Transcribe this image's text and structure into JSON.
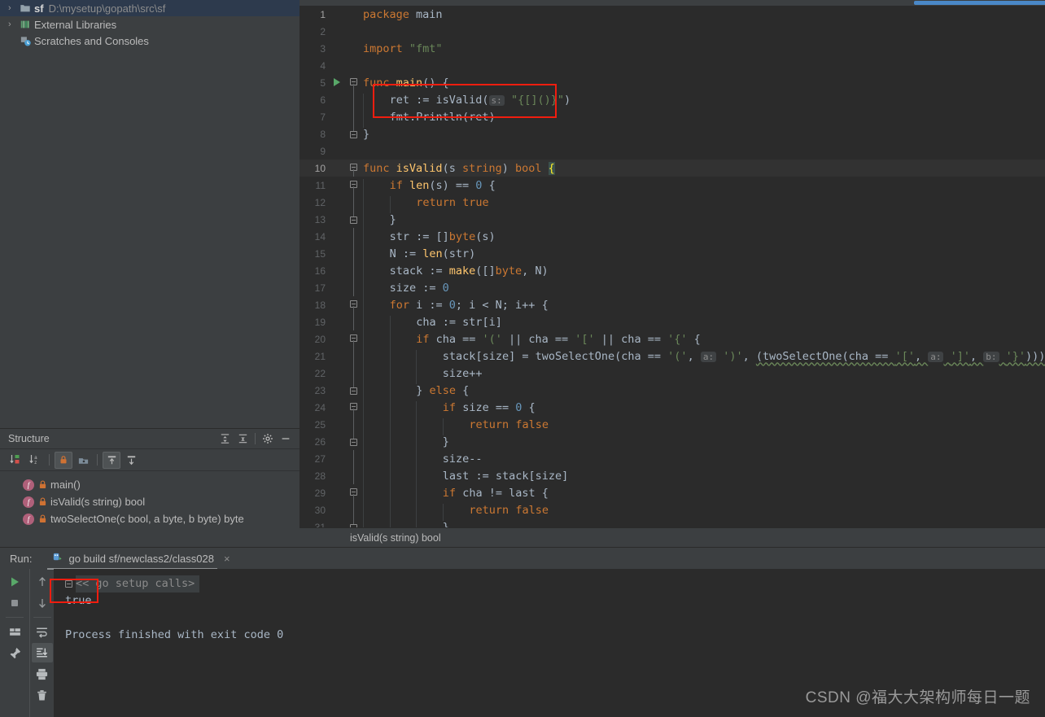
{
  "project_tree": {
    "items": [
      {
        "name": "sf",
        "path": "D:\\mysetup\\gopath\\src\\sf",
        "icon": "folder-icon",
        "arrow": "›",
        "selected": true
      },
      {
        "name": "External Libraries",
        "path": "",
        "icon": "libraries-icon",
        "arrow": "›",
        "selected": false
      },
      {
        "name": "Scratches and Consoles",
        "path": "",
        "icon": "scratches-icon",
        "arrow": "",
        "selected": false
      }
    ]
  },
  "structure": {
    "title": "Structure",
    "header_buttons": [
      {
        "name": "expand-all-icon",
        "glyph": "expand"
      },
      {
        "name": "collapse-all-icon",
        "glyph": "collapse"
      },
      {
        "name": "gear-icon",
        "glyph": "gear"
      },
      {
        "name": "hide-icon",
        "glyph": "minus"
      }
    ],
    "toolbar_buttons": [
      {
        "name": "sort-by-visibility-icon",
        "active": false
      },
      {
        "name": "sort-alphabetically-icon",
        "active": false
      },
      {
        "name": "show-non-public-icon",
        "active": true
      },
      {
        "name": "show-fields-icon",
        "active": false
      },
      {
        "name": "show-inherited-icon",
        "active": true
      },
      {
        "name": "show-anonymous-icon",
        "active": false
      }
    ],
    "items": [
      {
        "badge": "f",
        "label": "main()"
      },
      {
        "badge": "f",
        "label": "isValid(s string) bool"
      },
      {
        "badge": "f",
        "label": "twoSelectOne(c bool, a byte, b byte) byte"
      }
    ]
  },
  "editor": {
    "breadcrumb": "isValid(s string) bool",
    "current_line": 10,
    "lines": [
      {
        "n": 1,
        "fold": "",
        "indent": 0,
        "tokens": [
          {
            "t": "package",
            "c": "kw"
          },
          {
            "t": " main",
            "c": "txt"
          }
        ]
      },
      {
        "n": 2,
        "fold": "",
        "indent": 0,
        "tokens": []
      },
      {
        "n": 3,
        "fold": "",
        "indent": 0,
        "tokens": [
          {
            "t": "import",
            "c": "kw"
          },
          {
            "t": " ",
            "c": "txt"
          },
          {
            "t": "\"fmt\"",
            "c": "str"
          }
        ]
      },
      {
        "n": 4,
        "fold": "",
        "indent": 0,
        "tokens": []
      },
      {
        "n": 5,
        "fold": "start",
        "run": true,
        "indent": 0,
        "tokens": [
          {
            "t": "func",
            "c": "kw"
          },
          {
            "t": " ",
            "c": "txt"
          },
          {
            "t": "main",
            "c": "fn"
          },
          {
            "t": "() {",
            "c": "txt"
          }
        ]
      },
      {
        "n": 6,
        "fold": "bar",
        "indent": 1,
        "tokens": [
          {
            "t": "ret",
            "c": "txt"
          },
          {
            "t": " := ",
            "c": "txt"
          },
          {
            "t": "isValid",
            "c": "txt"
          },
          {
            "t": "(",
            "c": "txt"
          },
          {
            "t": "s:",
            "c": "hint"
          },
          {
            "t": " ",
            "c": "txt"
          },
          {
            "t": "\"{[]()}\"",
            "c": "str"
          },
          {
            "t": ")",
            "c": "txt"
          }
        ]
      },
      {
        "n": 7,
        "fold": "bar",
        "indent": 1,
        "tokens": [
          {
            "t": "fmt",
            "c": "txt"
          },
          {
            "t": ".",
            "c": "txt"
          },
          {
            "t": "Println",
            "c": "txt"
          },
          {
            "t": "(ret)",
            "c": "txt"
          }
        ]
      },
      {
        "n": 8,
        "fold": "end",
        "indent": 0,
        "tokens": [
          {
            "t": "}",
            "c": "txt"
          }
        ]
      },
      {
        "n": 9,
        "fold": "",
        "indent": 0,
        "tokens": []
      },
      {
        "n": 10,
        "fold": "start",
        "cur": true,
        "indent": 0,
        "tokens": [
          {
            "t": "func",
            "c": "kw"
          },
          {
            "t": " ",
            "c": "txt"
          },
          {
            "t": "isValid",
            "c": "fn"
          },
          {
            "t": "(s ",
            "c": "txt"
          },
          {
            "t": "string",
            "c": "kw"
          },
          {
            "t": ") ",
            "c": "txt"
          },
          {
            "t": "bool",
            "c": "kw"
          },
          {
            "t": " ",
            "c": "txt"
          },
          {
            "t": "{",
            "c": "brace-hl"
          }
        ]
      },
      {
        "n": 11,
        "fold": "start",
        "indent": 1,
        "tokens": [
          {
            "t": "if",
            "c": "kw"
          },
          {
            "t": " ",
            "c": "txt"
          },
          {
            "t": "len",
            "c": "fn"
          },
          {
            "t": "(s) == ",
            "c": "txt"
          },
          {
            "t": "0",
            "c": "num"
          },
          {
            "t": " {",
            "c": "txt"
          }
        ]
      },
      {
        "n": 12,
        "fold": "bar",
        "indent": 2,
        "tokens": [
          {
            "t": "return",
            "c": "kw"
          },
          {
            "t": " ",
            "c": "txt"
          },
          {
            "t": "true",
            "c": "kw"
          }
        ]
      },
      {
        "n": 13,
        "fold": "end",
        "indent": 1,
        "tokens": [
          {
            "t": "}",
            "c": "txt"
          }
        ]
      },
      {
        "n": 14,
        "fold": "bar",
        "indent": 1,
        "tokens": [
          {
            "t": "str",
            "c": "txt"
          },
          {
            "t": " := []",
            "c": "txt"
          },
          {
            "t": "byte",
            "c": "kw"
          },
          {
            "t": "(s)",
            "c": "txt"
          }
        ]
      },
      {
        "n": 15,
        "fold": "bar",
        "indent": 1,
        "tokens": [
          {
            "t": "N",
            "c": "txt"
          },
          {
            "t": " := ",
            "c": "txt"
          },
          {
            "t": "len",
            "c": "fn"
          },
          {
            "t": "(str)",
            "c": "txt"
          }
        ]
      },
      {
        "n": 16,
        "fold": "bar",
        "indent": 1,
        "tokens": [
          {
            "t": "stack",
            "c": "txt"
          },
          {
            "t": " := ",
            "c": "txt"
          },
          {
            "t": "make",
            "c": "fn"
          },
          {
            "t": "([]",
            "c": "txt"
          },
          {
            "t": "byte",
            "c": "kw"
          },
          {
            "t": ", N)",
            "c": "txt"
          }
        ]
      },
      {
        "n": 17,
        "fold": "bar",
        "indent": 1,
        "tokens": [
          {
            "t": "size",
            "c": "txt"
          },
          {
            "t": " := ",
            "c": "txt"
          },
          {
            "t": "0",
            "c": "num"
          }
        ]
      },
      {
        "n": 18,
        "fold": "start",
        "indent": 1,
        "tokens": [
          {
            "t": "for",
            "c": "kw"
          },
          {
            "t": " i := ",
            "c": "txt"
          },
          {
            "t": "0",
            "c": "num"
          },
          {
            "t": "; i < N; i++ {",
            "c": "txt"
          }
        ]
      },
      {
        "n": 19,
        "fold": "bar",
        "indent": 2,
        "tokens": [
          {
            "t": "cha",
            "c": "txt"
          },
          {
            "t": " := str[i]",
            "c": "txt"
          }
        ]
      },
      {
        "n": 20,
        "fold": "start",
        "indent": 2,
        "tokens": [
          {
            "t": "if",
            "c": "kw"
          },
          {
            "t": " cha == ",
            "c": "txt"
          },
          {
            "t": "'('",
            "c": "chr"
          },
          {
            "t": " || cha == ",
            "c": "txt"
          },
          {
            "t": "'['",
            "c": "chr"
          },
          {
            "t": " || cha == ",
            "c": "txt"
          },
          {
            "t": "'{'",
            "c": "chr"
          },
          {
            "t": " {",
            "c": "txt"
          }
        ]
      },
      {
        "n": 21,
        "fold": "bar",
        "indent": 3,
        "tokens": [
          {
            "t": "stack",
            "c": "txt"
          },
          {
            "t": "[size] = ",
            "c": "txt"
          },
          {
            "t": "twoSelectOne",
            "c": "txt"
          },
          {
            "t": "(cha == ",
            "c": "txt"
          },
          {
            "t": "'('",
            "c": "chr"
          },
          {
            "t": ", ",
            "c": "txt"
          },
          {
            "t": "a:",
            "c": "hint"
          },
          {
            "t": " ",
            "c": "txt"
          },
          {
            "t": "')'",
            "c": "chr"
          },
          {
            "t": ", ",
            "c": "txt"
          },
          {
            "t": "(twoSelectOne(cha == ",
            "c": "txt squiggle"
          },
          {
            "t": "'['",
            "c": "chr squiggle"
          },
          {
            "t": ", ",
            "c": "txt squiggle"
          },
          {
            "t": "a:",
            "c": "hint"
          },
          {
            "t": " ",
            "c": "txt squiggle"
          },
          {
            "t": "']'",
            "c": "chr squiggle"
          },
          {
            "t": ", ",
            "c": "txt squiggle"
          },
          {
            "t": "b:",
            "c": "hint"
          },
          {
            "t": " ",
            "c": "txt squiggle"
          },
          {
            "t": "'}'",
            "c": "chr squiggle"
          },
          {
            "t": ")))",
            "c": "txt squiggle"
          }
        ]
      },
      {
        "n": 22,
        "fold": "bar",
        "indent": 3,
        "tokens": [
          {
            "t": "size++",
            "c": "txt"
          }
        ]
      },
      {
        "n": 23,
        "fold": "end",
        "indent": 2,
        "tokens": [
          {
            "t": "} ",
            "c": "txt"
          },
          {
            "t": "else",
            "c": "kw"
          },
          {
            "t": " {",
            "c": "txt"
          }
        ]
      },
      {
        "n": 24,
        "fold": "start",
        "indent": 3,
        "tokens": [
          {
            "t": "if",
            "c": "kw"
          },
          {
            "t": " size == ",
            "c": "txt"
          },
          {
            "t": "0",
            "c": "num"
          },
          {
            "t": " {",
            "c": "txt"
          }
        ]
      },
      {
        "n": 25,
        "fold": "bar",
        "indent": 4,
        "tokens": [
          {
            "t": "return",
            "c": "kw"
          },
          {
            "t": " ",
            "c": "txt"
          },
          {
            "t": "false",
            "c": "kw"
          }
        ]
      },
      {
        "n": 26,
        "fold": "end",
        "indent": 3,
        "tokens": [
          {
            "t": "}",
            "c": "txt"
          }
        ]
      },
      {
        "n": 27,
        "fold": "bar",
        "indent": 3,
        "tokens": [
          {
            "t": "size--",
            "c": "txt"
          }
        ]
      },
      {
        "n": 28,
        "fold": "bar",
        "indent": 3,
        "tokens": [
          {
            "t": "last",
            "c": "txt"
          },
          {
            "t": " := stack[size]",
            "c": "txt"
          }
        ]
      },
      {
        "n": 29,
        "fold": "start",
        "indent": 3,
        "tokens": [
          {
            "t": "if",
            "c": "kw"
          },
          {
            "t": " cha != last {",
            "c": "txt"
          }
        ]
      },
      {
        "n": 30,
        "fold": "bar",
        "indent": 4,
        "tokens": [
          {
            "t": "return",
            "c": "kw"
          },
          {
            "t": " ",
            "c": "txt"
          },
          {
            "t": "false",
            "c": "kw"
          }
        ]
      },
      {
        "n": 31,
        "fold": "end",
        "indent": 3,
        "tokens": [
          {
            "t": "}",
            "c": "txt"
          }
        ]
      }
    ]
  },
  "run_panel": {
    "label": "Run:",
    "tab": {
      "title": "go build sf/newclass2/class028",
      "icon": "go-run-icon",
      "close": "×"
    },
    "side_buttons": [
      {
        "name": "rerun-button",
        "glyph": "play",
        "active": false
      },
      {
        "name": "stop-button",
        "glyph": "stop",
        "active": false
      },
      {
        "name": "layout-button",
        "glyph": "layout",
        "active": false
      },
      {
        "name": "pin-tab-button",
        "glyph": "pin",
        "active": false
      }
    ],
    "side_buttons2": [
      {
        "name": "prev-occurrence-button",
        "glyph": "up",
        "active": false
      },
      {
        "name": "next-occurrence-button",
        "glyph": "down",
        "active": false
      },
      {
        "name": "soft-wrap-button",
        "glyph": "wrap",
        "active": false
      },
      {
        "name": "scroll-to-end-button",
        "glyph": "scroll-end",
        "active": true
      },
      {
        "name": "print-button",
        "glyph": "print",
        "active": false
      },
      {
        "name": "clear-all-button",
        "glyph": "trash",
        "active": false
      }
    ],
    "console": [
      {
        "text": "<< go setup calls>",
        "style": "header"
      },
      {
        "text": "true",
        "style": "out"
      },
      {
        "text": "",
        "style": "out"
      },
      {
        "text": "Process finished with exit code 0",
        "style": "out"
      }
    ]
  },
  "annotations": {
    "code_box_label": "highlighted main body",
    "output_box_label": "highlighted true output"
  },
  "watermark": "CSDN @福大大架构师每日一题",
  "colors": {
    "editor_bg": "#2b2b2b",
    "panel_bg": "#3c3f41",
    "selection_bg": "#2d3a4d",
    "accent_blue": "#4a88c7",
    "annotation_red": "#f01d0f",
    "keyword": "#cc7832",
    "string": "#6a8759",
    "number": "#6897bb",
    "function": "#ffc66d",
    "text": "#a9b7c6"
  }
}
